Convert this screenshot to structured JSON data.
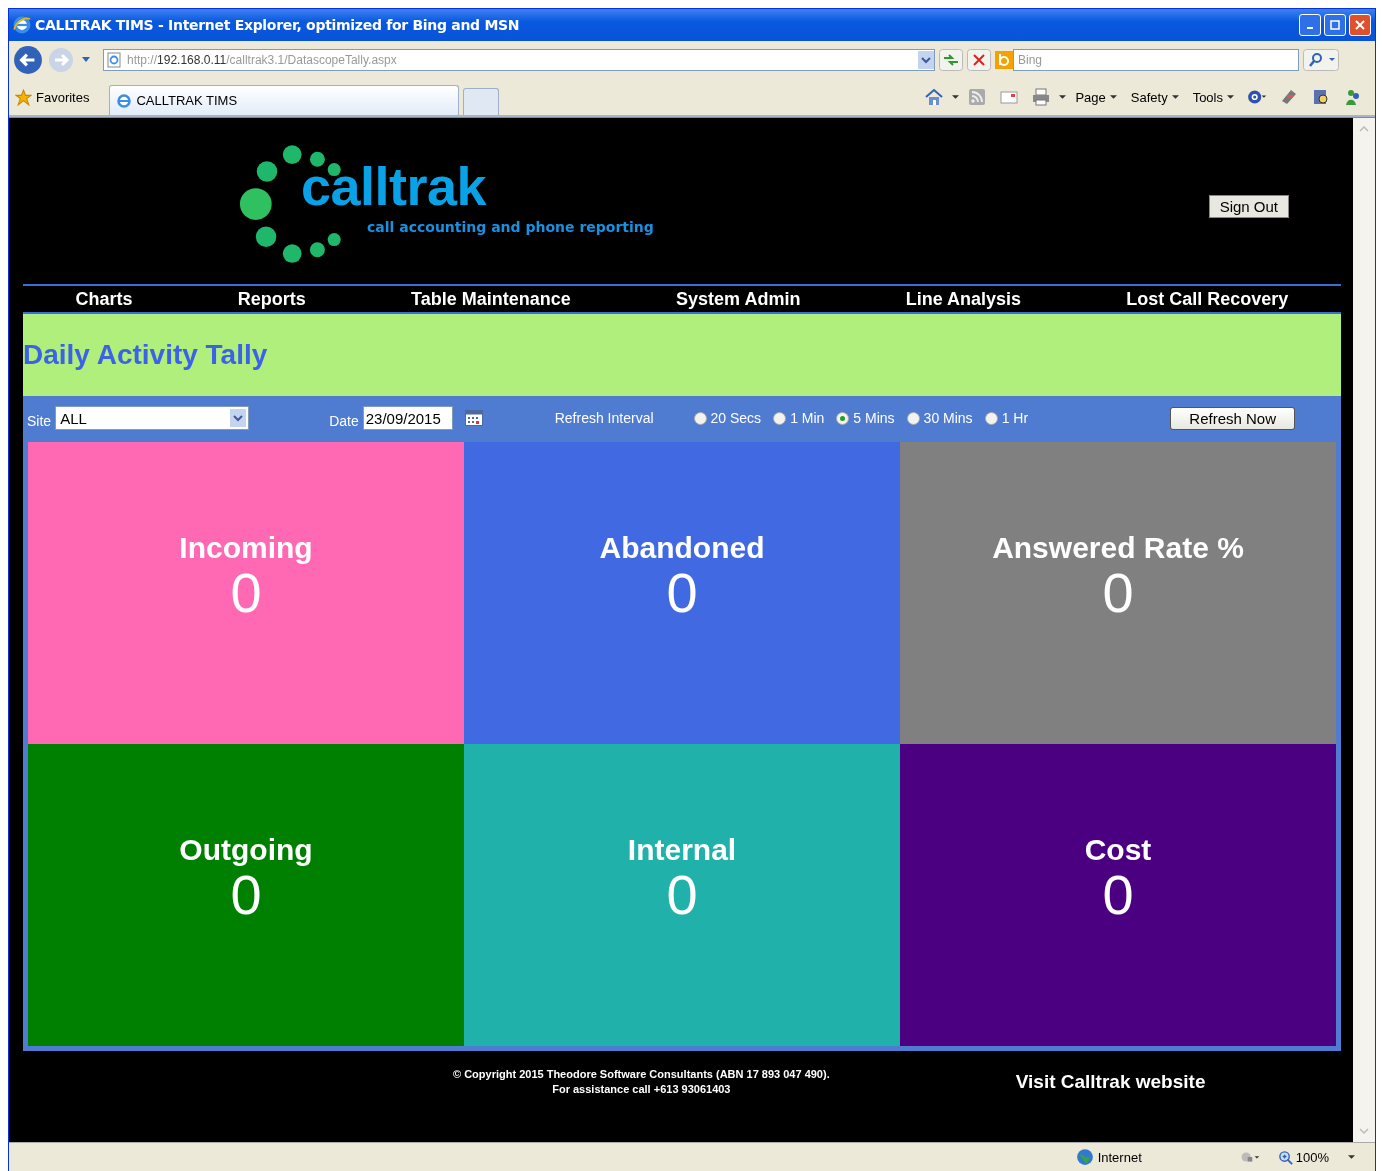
{
  "window": {
    "title": "CALLTRAK TIMS - Internet Explorer, optimized for Bing and MSN"
  },
  "address_bar": {
    "parts": [
      {
        "text": "http://",
        "emphasized": false
      },
      {
        "text": "192.168.0.11",
        "emphasized": true
      },
      {
        "text": "/calltrak3.1/DatascopeTally.aspx",
        "emphasized": false
      }
    ]
  },
  "search": {
    "placeholder": "Bing"
  },
  "favorites": "Favorites",
  "tabs": [
    {
      "label": "CALLTRAK TIMS",
      "selected": true
    }
  ],
  "command_bar": [
    "Page",
    "Safety",
    "Tools"
  ],
  "page": {
    "logo": {
      "name": "calltrak",
      "tagline": "call accounting and phone reporting"
    },
    "sign_out": "Sign Out",
    "nav": [
      "Charts",
      "Reports",
      "Table Maintenance",
      "System Admin",
      "Line Analysis",
      "Lost Call Recovery"
    ],
    "heading": "Daily Activity Tally",
    "filters": {
      "site_label": "Site",
      "site_value": "ALL",
      "date_label": "Date",
      "date_value": "23/09/2015",
      "refresh_label": "Refresh Interval",
      "intervals": [
        {
          "label": "20 Secs",
          "selected": false
        },
        {
          "label": "1 Min",
          "selected": false
        },
        {
          "label": "5 Mins",
          "selected": true
        },
        {
          "label": "30 Mins",
          "selected": false
        },
        {
          "label": "1 Hr",
          "selected": false
        }
      ],
      "refresh_button": "Refresh Now"
    },
    "tiles": [
      {
        "title": "Incoming",
        "value": "0",
        "color": "#ff69b4"
      },
      {
        "title": "Abandoned",
        "value": "0",
        "color": "#4169e1"
      },
      {
        "title": "Answered Rate %",
        "value": "0",
        "color": "#808080"
      },
      {
        "title": "Outgoing",
        "value": "0",
        "color": "#008000"
      },
      {
        "title": "Internal",
        "value": "0",
        "color": "#20b2aa"
      },
      {
        "title": "Cost",
        "value": "0",
        "color": "#4b0082"
      }
    ],
    "footer": {
      "copyright": [
        "© Copyright 2015 Theodore Software Consultants (ABN 17 893 047 490).",
        "For assistance call +613 93061403"
      ],
      "link": "Visit Calltrak website"
    }
  },
  "status_bar": {
    "zone": "Internet",
    "zoom": "100%"
  }
}
